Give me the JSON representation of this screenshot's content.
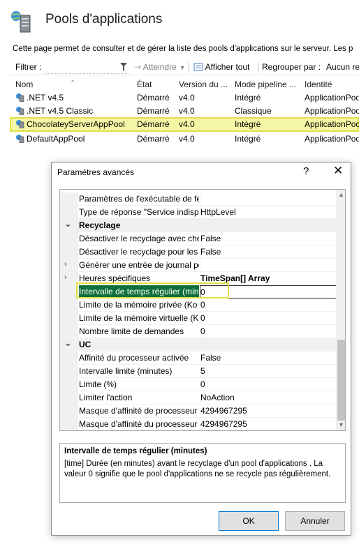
{
  "header": {
    "title": "Pools d'applications",
    "description": "Cette page permet de consulter et de gérer la liste des pools d'applications sur le serveur. Les p"
  },
  "toolbar": {
    "filter_label": "Filtrer :",
    "filter_value": "",
    "reach_label": "Atteindre",
    "show_all_label": "Afficher tout",
    "group_label": "Regrouper par :",
    "group_value": "Aucun re"
  },
  "list": {
    "headers": [
      "Nom",
      "État",
      "Version du ...",
      "Mode pipeline ...",
      "Identité"
    ],
    "rows": [
      {
        "name": ".NET v4.5",
        "state": "Démarré",
        "version": "v4.0",
        "mode": "Intégré",
        "identity": "ApplicationPool"
      },
      {
        "name": ".NET v4.5 Classic",
        "state": "Démarré",
        "version": "v4.0",
        "mode": "Classique",
        "identity": "ApplicationPool"
      },
      {
        "name": "ChocolateyServerAppPool",
        "state": "Démarré",
        "version": "v4.0",
        "mode": "Intégré",
        "identity": "ApplicationPool"
      },
      {
        "name": "DefaultAppPool",
        "state": "Démarré",
        "version": "v4.0",
        "mode": "Intégré",
        "identity": "ApplicationPool"
      }
    ]
  },
  "dialog": {
    "title": "Paramètres avancés",
    "help": "?",
    "close": "✕",
    "properties": [
      {
        "name": "Paramètres de l'exécutable de fe",
        "value": ""
      },
      {
        "name": "Type de réponse \"Service indispo",
        "value": "HttpLevel"
      },
      {
        "name": "Recyclage",
        "value": "",
        "category": true
      },
      {
        "name": "Désactiver le recyclage avec che",
        "value": "False"
      },
      {
        "name": "Désactiver le recyclage pour les m",
        "value": "False"
      },
      {
        "name": "Générer une entrée de journal po",
        "value": "",
        "expander": true
      },
      {
        "name": "Heures spécifiques",
        "value": "TimeSpan[] Array",
        "expander": true
      },
      {
        "name": "Intervalle de temps régulier (min",
        "value": "0",
        "selected": true
      },
      {
        "name": "Limite de la mémoire privée (Ko",
        "value": "0"
      },
      {
        "name": "Limite de la mémoire virtuelle (K",
        "value": "0"
      },
      {
        "name": "Nombre limite de demandes",
        "value": "0"
      },
      {
        "name": "UC",
        "value": "",
        "category": true
      },
      {
        "name": "Affinité du processeur activée",
        "value": "False"
      },
      {
        "name": "Intervalle limite (minutes)",
        "value": "5"
      },
      {
        "name": "Limite (%)",
        "value": "0"
      },
      {
        "name": "Limiter l'action",
        "value": "NoAction"
      },
      {
        "name": "Masque d'affinité de processeur",
        "value": "4294967295"
      },
      {
        "name": "Masque d'affinité du processeur",
        "value": "4294967295"
      }
    ],
    "description_title": "Intervalle de temps régulier (minutes)",
    "description_text": "[time] Durée (en minutes) avant le recyclage d'un pool d'applications .  La valeur 0 signifie que le pool d'applications ne se recycle pas régulièrement.",
    "ok_label": "OK",
    "cancel_label": "Annuler"
  },
  "colors": {
    "selection_highlight": "#f5f5a6",
    "highlight_border": "#e3df48",
    "selected_property_bg": "#0f6f3a"
  }
}
